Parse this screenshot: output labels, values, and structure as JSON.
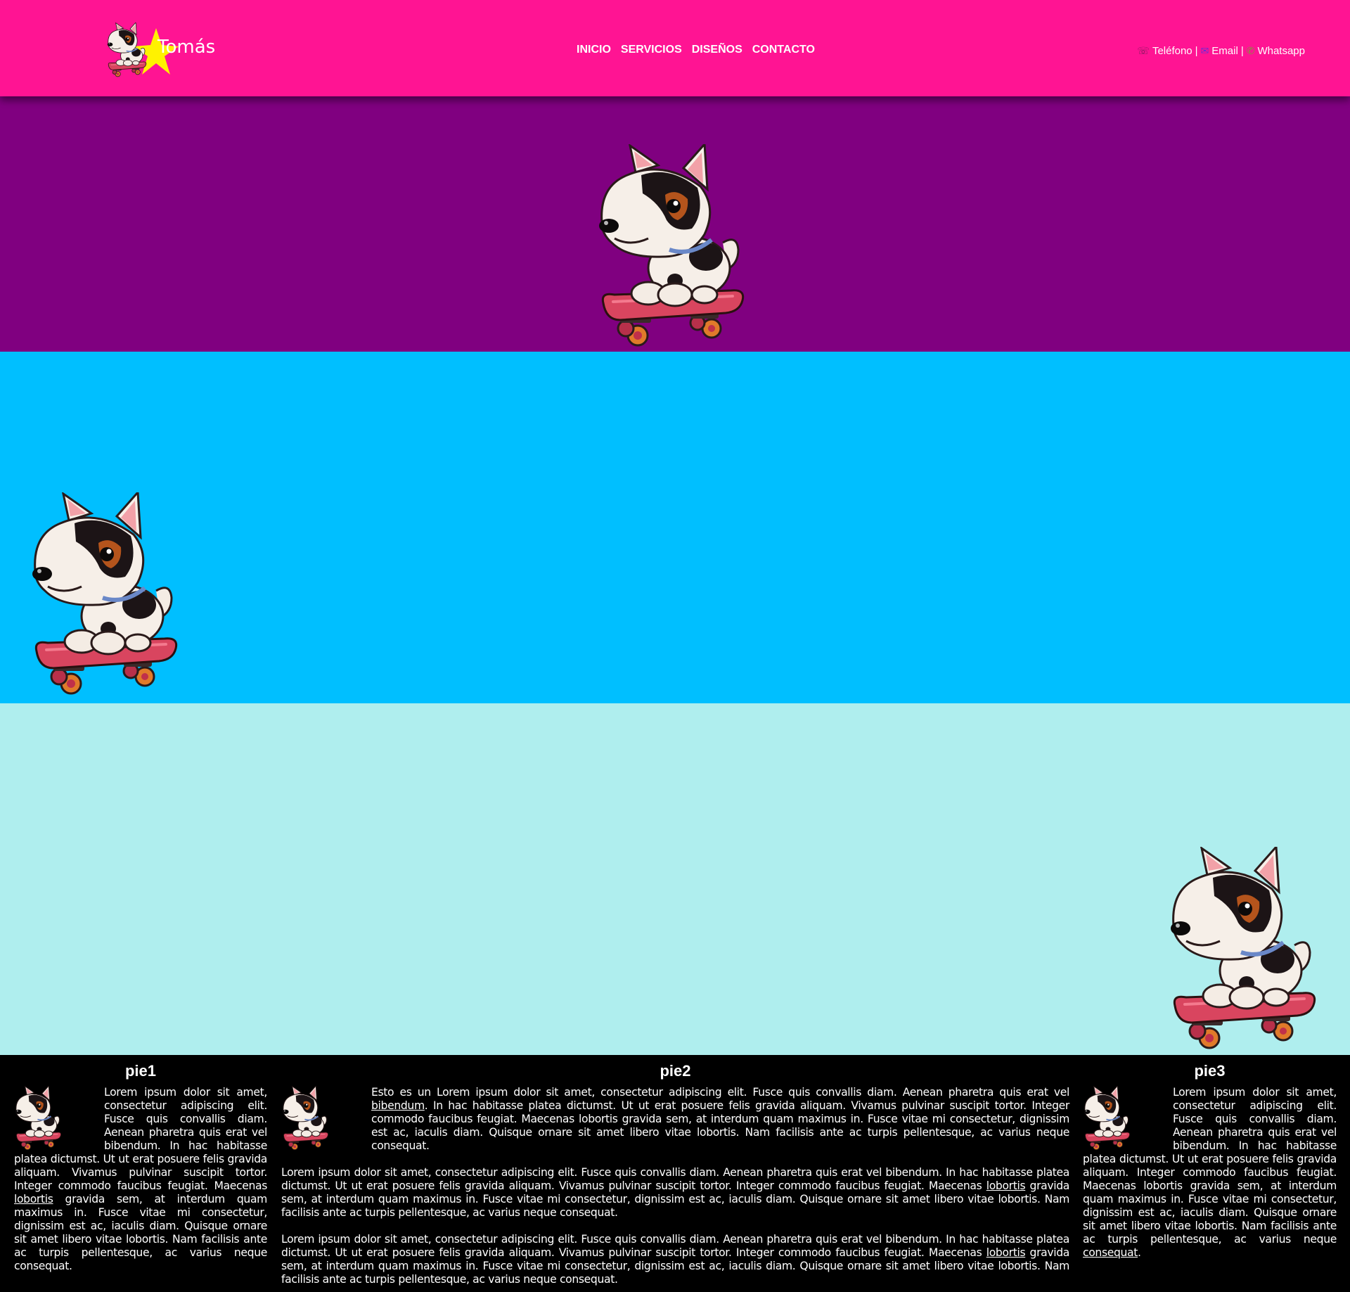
{
  "header": {
    "brand_name": "Tomás",
    "nav": [
      "INICIO",
      "SERVICIOS",
      "DISEÑOS",
      "CONTACTO"
    ],
    "contact": {
      "phone": "Teléfono",
      "email": "Email",
      "whatsapp": "Whatsapp",
      "sep": "|"
    }
  },
  "icons": {
    "phone": "☏",
    "email": "✉",
    "whatsapp": "✆"
  },
  "colors": {
    "header": "#ff1493",
    "band_1": "#800080",
    "band_2": "#00bfff",
    "band_3": "#afeeee",
    "footer": "#000000"
  },
  "footer": {
    "col1": {
      "title": "pie1",
      "text_a": "Lorem ipsum dolor sit amet, consectetur adipiscing elit. Fusce quis convallis diam. Aenean pharetra quis erat vel bibendum. In hac habitasse platea dictumst. Ut ut erat posuere felis gravida aliquam. Vivamus pulvinar suscipit tortor. Integer commodo faucibus feugiat. Maecenas ",
      "link": "lobortis",
      "text_b": " gravida sem, at interdum quam maximus in. Fusce vitae mi consectetur, dignissim est ac, iaculis diam. Quisque ornare sit amet libero vitae lobortis. Nam facilisis ante ac turpis pellentesque, ac varius neque consequat."
    },
    "col2": {
      "title": "pie2",
      "p1_a": "Esto es un Lorem ipsum dolor sit amet, consectetur adipiscing elit. Fusce quis convallis diam. Aenean pharetra quis erat vel ",
      "p1_link": "bibendum",
      "p1_b": ". In hac habitasse platea dictumst. Ut ut erat posuere felis gravida aliquam. Vivamus pulvinar suscipit tortor. Integer commodo faucibus feugiat. Maecenas lobortis gravida sem, at interdum quam maximus in. Fusce vitae mi consectetur, dignissim est ac, iaculis diam. Quisque ornare sit amet libero vitae lobortis. Nam facilisis ante ac turpis pellentesque, ac varius neque consequat.",
      "p2_a": "Lorem ipsum dolor sit amet, consectetur adipiscing elit. Fusce quis convallis diam. Aenean pharetra quis erat vel bibendum. In hac habitasse platea dictumst. Ut ut erat posuere felis gravida aliquam. Vivamus pulvinar suscipit tortor. Integer commodo faucibus feugiat. Maecenas ",
      "p2_link": "lobortis",
      "p2_b": " gravida sem, at interdum quam maximus in. Fusce vitae mi consectetur, dignissim est ac, iaculis diam. Quisque ornare sit amet libero vitae lobortis. Nam facilisis ante ac turpis pellentesque, ac varius neque consequat.",
      "p3_a": "Lorem ipsum dolor sit amet, consectetur adipiscing elit. Fusce quis convallis diam. Aenean pharetra quis erat vel bibendum. In hac habitasse platea dictumst. Ut ut erat posuere felis gravida aliquam. Vivamus pulvinar suscipit tortor. Integer commodo faucibus feugiat. Maecenas ",
      "p3_link": "lobortis",
      "p3_b": " gravida sem, at interdum quam maximus in. Fusce vitae mi consectetur, dignissim est ac, iaculis diam. Quisque ornare sit amet libero vitae lobortis. Nam facilisis ante ac turpis pellentesque, ac varius neque consequat."
    },
    "col3": {
      "title": "pie3",
      "text_a": "Lorem ipsum dolor sit amet, consectetur adipiscing elit. Fusce quis convallis diam. Aenean pharetra quis erat vel bibendum. In hac habitasse platea dictumst. Ut ut erat posuere felis gravida aliquam. Integer commodo faucibus feugiat. Maecenas lobortis gravida sem, at interdum quam maximus in. Fusce vitae mi consectetur, dignissim est ac, iaculis diam. Quisque ornare sit amet libero vitae lobortis. Nam facilisis ante ac turpis pellentesque, ac varius neque ",
      "link": "consequat",
      "text_b": "."
    }
  }
}
